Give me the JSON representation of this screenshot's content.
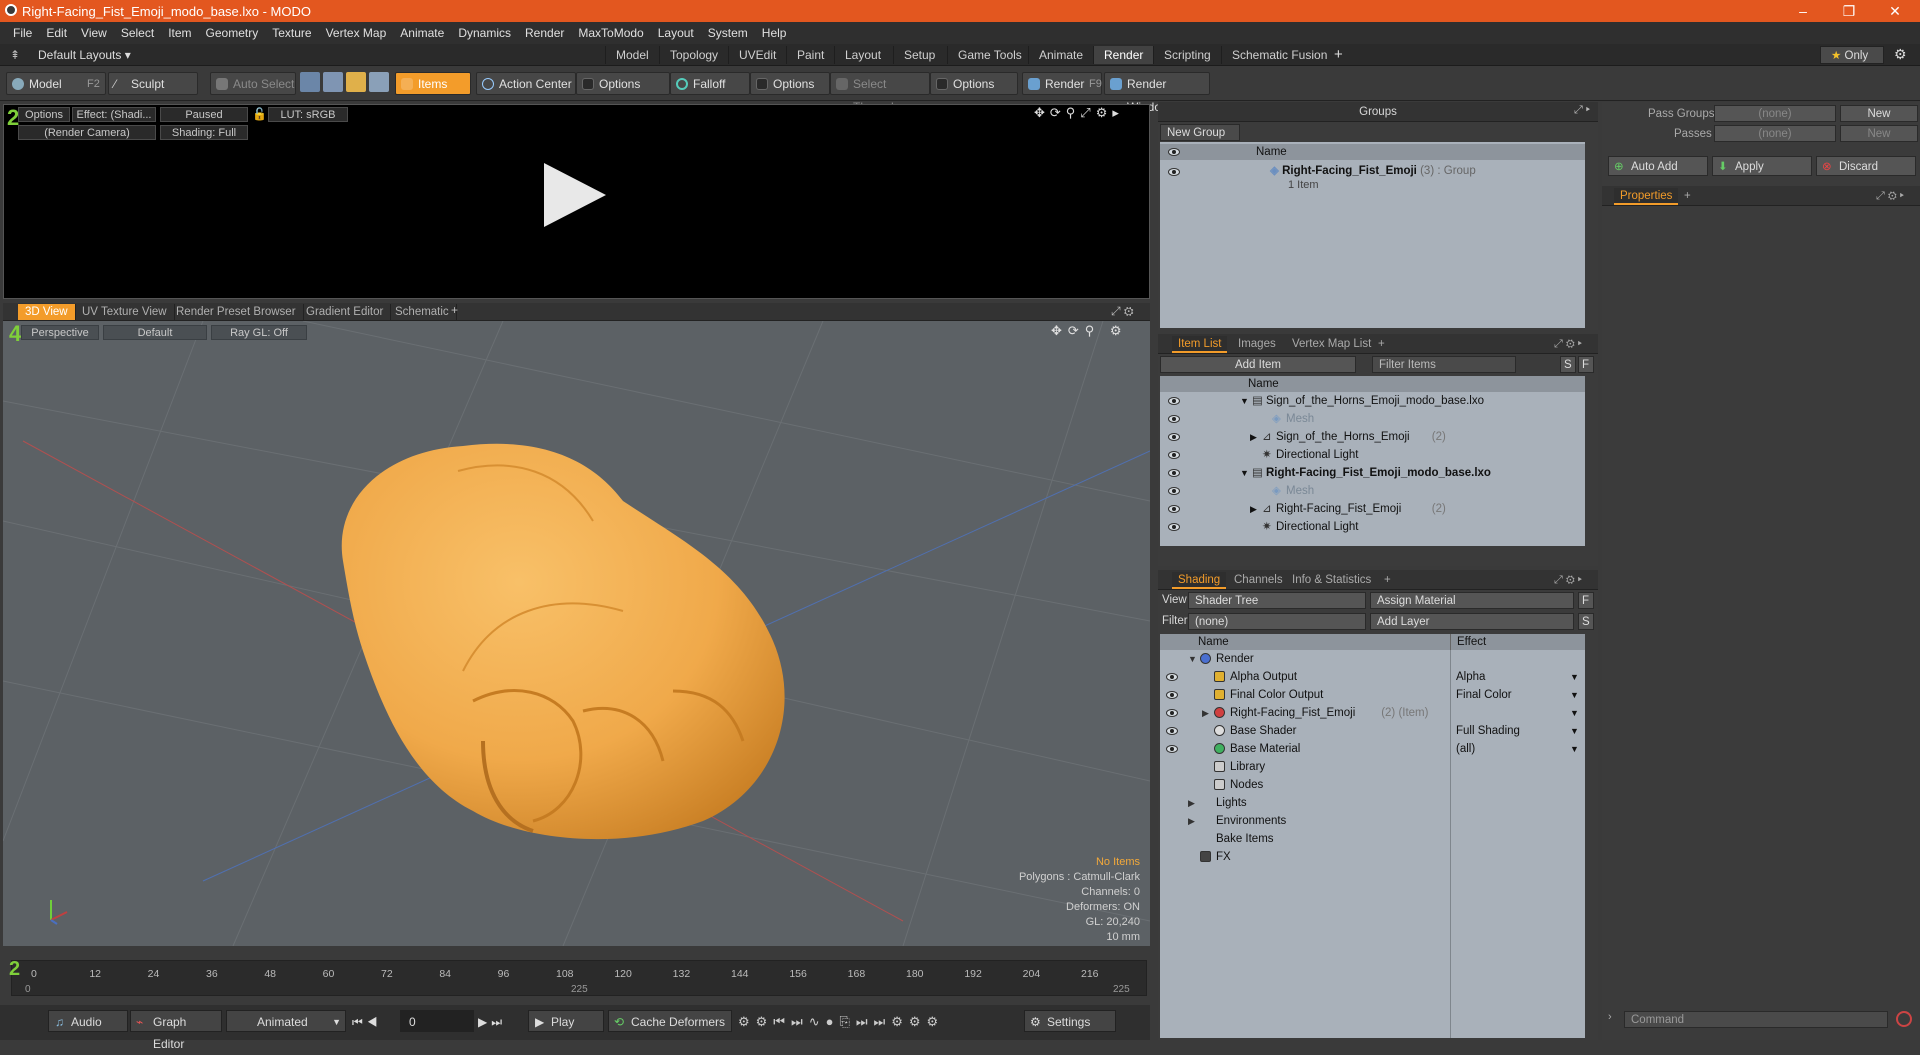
{
  "window": {
    "title": "Right-Facing_Fist_Emoji_modo_base.lxo - MODO"
  },
  "menu": [
    "File",
    "Edit",
    "View",
    "Select",
    "Item",
    "Geometry",
    "Texture",
    "Vertex Map",
    "Animate",
    "Dynamics",
    "Render",
    "MaxToModo",
    "Layout",
    "System",
    "Help"
  ],
  "layouts": {
    "preset": "Default Layouts ▾",
    "tabs": [
      "Model",
      "Topology",
      "UVEdit",
      "Paint",
      "Layout",
      "Setup",
      "Game Tools",
      "Animate",
      "Render",
      "Scripting",
      "Schematic Fusion"
    ],
    "active": "Render",
    "add": "+",
    "only": "Only"
  },
  "toolbar": {
    "model": "Model",
    "model_key": "F2",
    "sculpt": "Sculpt",
    "auto_select": "Auto Select",
    "items": "Items",
    "action_center": "Action Center",
    "options1": "Options",
    "falloff": "Falloff",
    "options2": "Options",
    "select_through": "Select Through",
    "options3": "Options",
    "render": "Render",
    "render_key": "F9",
    "render_window": "Render Window"
  },
  "render_view": {
    "options": "Options",
    "effect": "Effect: (Shadi...",
    "paused": "Paused",
    "lut": "LUT: sRGB",
    "camera": "(Render Camera)",
    "shading": "Shading: Full"
  },
  "view_tabs": [
    "3D View",
    "UV Texture View",
    "Render Preset Browser",
    "Gradient Editor",
    "Schematic"
  ],
  "view_tabs_add": "+",
  "view3d": {
    "perspective": "Perspective",
    "default": "Default",
    "raygl": "Ray GL: Off",
    "info": [
      "No Items",
      "Polygons : Catmull-Clark",
      "Channels: 0",
      "Deformers: ON",
      "GL: 20,240",
      "10 mm"
    ]
  },
  "timeline": {
    "ticks": [
      "0",
      "12",
      "24",
      "36",
      "48",
      "60",
      "72",
      "84",
      "96",
      "108",
      "120",
      "132",
      "144",
      "156",
      "168",
      "180",
      "192",
      "204",
      "216"
    ],
    "sub_ticks": [
      "0",
      "225",
      "225"
    ]
  },
  "bottom": {
    "audio": "Audio",
    "graph_editor": "Graph Editor",
    "animated": "Animated",
    "frame": "0",
    "play": "Play",
    "cache": "Cache Deformers",
    "settings": "Settings"
  },
  "groups": {
    "title": "Groups",
    "new_group": "New Group",
    "col_name": "Name",
    "item_name": "Right-Facing_Fist_Emoji",
    "item_count": "(3)",
    "item_type": ": Group",
    "item_sub": "1 Item"
  },
  "pass": {
    "pass_groups": "Pass Groups",
    "passes": "Passes",
    "none": "(none)",
    "new": "New",
    "auto_add": "Auto Add",
    "apply": "Apply",
    "discard": "Discard",
    "properties": "Properties",
    "add": "+"
  },
  "item_list": {
    "tabs": [
      "Item List",
      "Images",
      "Vertex Map List"
    ],
    "add": "+",
    "add_item": "Add Item",
    "filter": "Filter Items",
    "s": "S",
    "f": "F",
    "col_name": "Name",
    "rows": [
      {
        "label": "Sign_of_the_Horns_Emoji_modo_base.lxo",
        "indent": 0,
        "bold": false
      },
      {
        "label": "Mesh",
        "indent": 2,
        "bold": false,
        "dim": true
      },
      {
        "label": "Sign_of_the_Horns_Emoji",
        "count": "(2)",
        "indent": 1,
        "bold": false
      },
      {
        "label": "Directional Light",
        "indent": 1,
        "bold": false
      },
      {
        "label": "Right-Facing_Fist_Emoji_modo_base.lxo",
        "indent": 0,
        "bold": true
      },
      {
        "label": "Mesh",
        "indent": 2,
        "bold": false,
        "dim": true
      },
      {
        "label": "Right-Facing_Fist_Emoji",
        "count": "(2)",
        "indent": 1,
        "bold": false
      },
      {
        "label": "Directional Light",
        "indent": 1,
        "bold": false
      }
    ]
  },
  "shading": {
    "tabs": [
      "Shading",
      "Channels",
      "Info & Statistics"
    ],
    "add": "+",
    "view_label": "View",
    "view_value": "Shader Tree",
    "assign": "Assign Material",
    "filter_label": "Filter",
    "filter_value": "(none)",
    "add_layer": "Add Layer",
    "f": "F",
    "s": "S",
    "col_name": "Name",
    "col_effect": "Effect",
    "rows": [
      {
        "label": "Render",
        "effect": "",
        "indent": 0
      },
      {
        "label": "Alpha Output",
        "effect": "Alpha",
        "indent": 1
      },
      {
        "label": "Final Color Output",
        "effect": "Final Color",
        "indent": 1
      },
      {
        "label": "Right-Facing_Fist_Emoji",
        "suffix": "(2) (Item)",
        "effect": "",
        "indent": 1
      },
      {
        "label": "Base Shader",
        "effect": "Full Shading",
        "indent": 1
      },
      {
        "label": "Base Material",
        "effect": "(all)",
        "indent": 1
      },
      {
        "label": "Library",
        "effect": "",
        "indent": 1
      },
      {
        "label": "Nodes",
        "effect": "",
        "indent": 1
      },
      {
        "label": "Lights",
        "effect": "",
        "indent": 0
      },
      {
        "label": "Environments",
        "effect": "",
        "indent": 0
      },
      {
        "label": "Bake Items",
        "effect": "",
        "indent": 0
      },
      {
        "label": "FX",
        "effect": "",
        "indent": 0
      }
    ]
  },
  "command": {
    "placeholder": "Command"
  },
  "colors": {
    "accent": "#f39c2a",
    "titlebar": "#e3571f",
    "skin": "#f0a94a"
  }
}
